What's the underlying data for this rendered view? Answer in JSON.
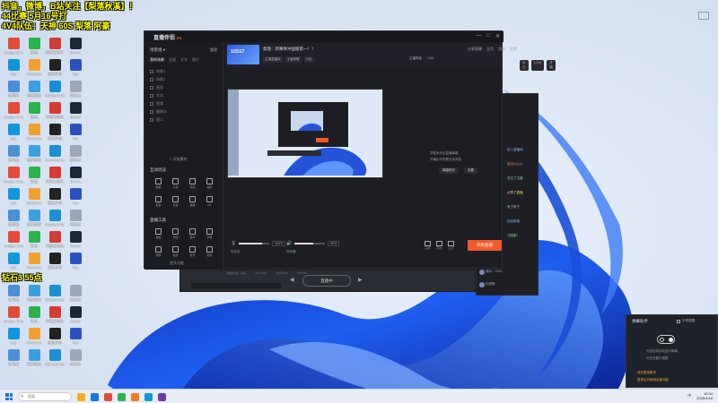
{
  "overlay": {
    "line1": "抖音，微博，B站关注【梨落秋溪】！",
    "line2": "44比赛 5月16号打",
    "line3": "4V4队伍：天神 60S 梨落 阿豪",
    "line4": "钻石3 55点"
  },
  "desktop_icons": [
    {
      "label": "Google Chrome",
      "color": "#e04b3a"
    },
    {
      "label": "微信",
      "color": "#2bb24c"
    },
    {
      "label": "网易云音乐",
      "color": "#d43c33"
    },
    {
      "label": "Steam",
      "color": "#1b2838"
    },
    {
      "label": "QQ",
      "color": "#1296db"
    },
    {
      "label": "WeGame",
      "color": "#f0a030"
    },
    {
      "label": "直播伴侣",
      "color": "#222"
    },
    {
      "label": "Top",
      "color": "#2a52be"
    },
    {
      "label": "此电脑",
      "color": "#4a90d9"
    },
    {
      "label": "控制面板",
      "color": "#3aa0e0"
    },
    {
      "label": "Microsoft Edge",
      "color": "#1a8fd6"
    },
    {
      "label": "回收站",
      "color": "#9aa8b8"
    }
  ],
  "app": {
    "logo": "直播伴侣",
    "logo_badge": "PC",
    "window_controls": [
      "—",
      "□",
      "✕"
    ],
    "profile": {
      "title": "梨落：新赛季冲国服第一！！",
      "tags": [
        "主播直播间",
        "王者荣耀",
        "分区"
      ],
      "stats": [
        "主播等级",
        "1421",
        "1/2517"
      ],
      "right": [
        "分享直播",
        "主页",
        "消息",
        "设置"
      ],
      "pills": [
        "中文",
        "1/120",
        "开播"
      ]
    },
    "sidebar": {
      "header": "场景组 ▾",
      "header_right": "管理",
      "tabs": [
        "我的场景",
        "全部",
        "文字",
        "图片"
      ],
      "scenes": [
        "场景1",
        "场景2",
        "画面",
        "文本",
        "视频",
        "摄像头",
        "窗口"
      ],
      "add_label": "+ 添加素材",
      "section1": "互动玩法",
      "tools1": [
        "弹幕",
        "礼物",
        "连线",
        "抽奖",
        "投票",
        "点赞",
        "福袋",
        "PK"
      ],
      "section2": "直播工具",
      "tools2": [
        "美颜",
        "滤镜",
        "变声",
        "字幕",
        "录屏",
        "贴纸",
        "音乐",
        "更多"
      ],
      "bottom": "更多功能"
    },
    "right_message": {
      "line1": "您暂未开启直播弹幕",
      "line2": "开播后可查看互动消息",
      "buttons": [
        "弹幕助手",
        "设置"
      ]
    },
    "controls": {
      "mic_label": "麦克风",
      "mic_pct": "100%",
      "mic_level": 0.75,
      "speaker_label": "扬声器",
      "speaker_pct": "80%",
      "speaker_level": 0.6,
      "icons": [
        "画质",
        "录制",
        "设置"
      ],
      "start_button": "开始直播"
    },
    "status": [
      "网络状态：良好",
      "CPU 45%",
      "内存 60%",
      "FPS 60"
    ]
  },
  "win2": {
    "button": "直播中",
    "left_arrow": "◀",
    "right_arrow": "▶"
  },
  "chat": {
    "head": "直播间",
    "sub": "观众列表",
    "big": "53",
    "lines": [
      {
        "text": "进入直播间",
        "color": "#8ab4f8"
      },
      {
        "text": "送出小心心",
        "color": "#f28b82"
      },
      {
        "text": "关注了主播",
        "color": "#81c995"
      },
      {
        "text": "点赞了直播",
        "color": "#fdd663"
      },
      {
        "text": "来了来了",
        "color": "#cccccc"
      },
      {
        "text": "加油梨落",
        "color": "#8ab4f8"
      },
      {
        "text": "冲国服！",
        "color": "#81c995"
      }
    ],
    "foot1": "观众：2021",
    "foot2": "礼物榜"
  },
  "notify": {
    "title": "弹幕助手",
    "check": "不再提醒",
    "text1": "开启后将自动显示弹幕",
    "text2": "可在设置中调整",
    "warn1": "请先登录账号",
    "warn2": "登录后可使用全部功能"
  },
  "taskbar": {
    "search_placeholder": "搜索",
    "app_colors": [
      "#f2b01e",
      "#1a73e8",
      "#e04b3a",
      "#2bb24c",
      "#f07c22",
      "#1296db",
      "#6b3fa0"
    ],
    "sys": "中",
    "time": "18:34",
    "date": "2026/4/18"
  },
  "colors": {
    "accent": "#f25a29",
    "overlay_text": "#ffff00"
  }
}
